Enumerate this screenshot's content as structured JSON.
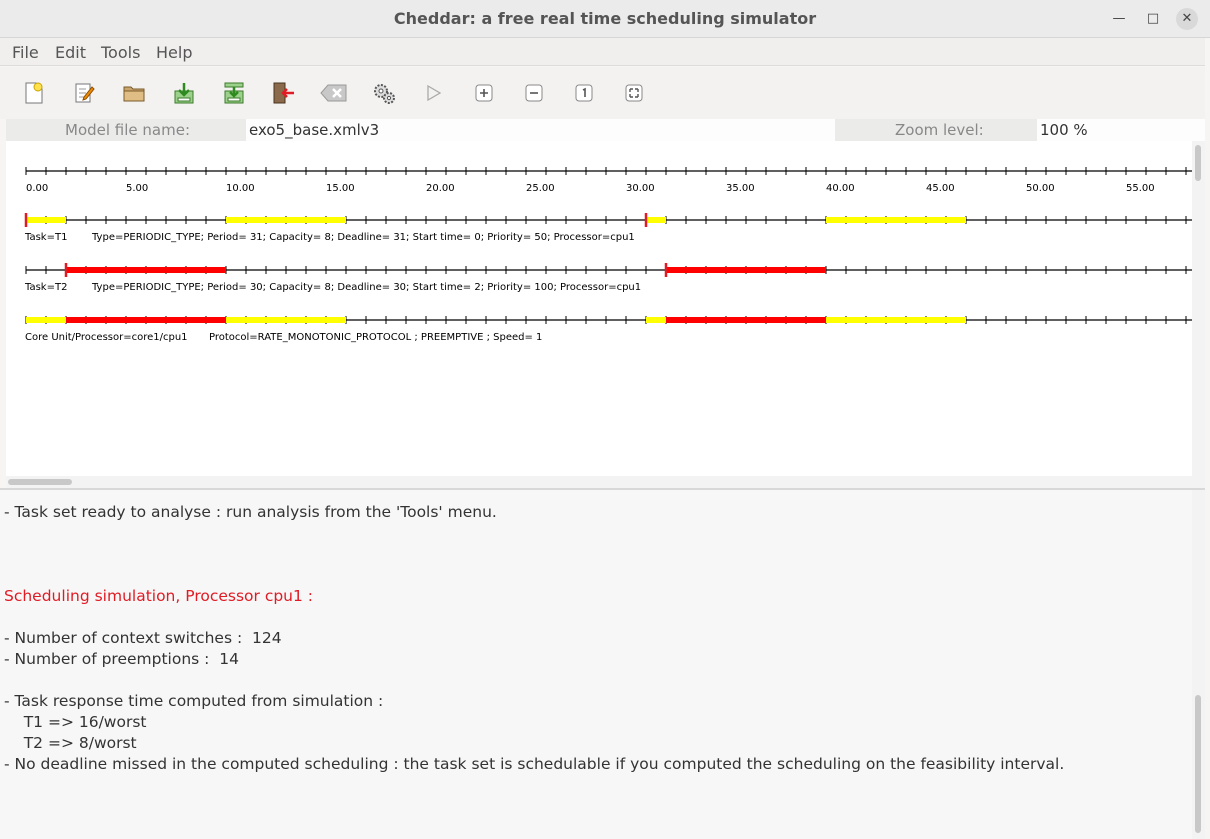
{
  "window": {
    "title": "Cheddar: a free real time scheduling simulator",
    "minimize_glyph": "—",
    "maximize_glyph": "□",
    "close_glyph": "✕"
  },
  "menu": [
    {
      "label": "File"
    },
    {
      "label": "Edit"
    },
    {
      "label": "Tools"
    },
    {
      "label": "Help"
    }
  ],
  "toolbar": {
    "icons": [
      "new-file-icon",
      "edit-icon",
      "open-folder-icon",
      "save-icon",
      "save-as-icon",
      "exit-icon",
      "clear-icon",
      "settings-gears-icon",
      "run-icon",
      "zoom-in-icon",
      "zoom-out-icon",
      "zoom-reset-icon",
      "zoom-fit-icon"
    ]
  },
  "model": {
    "file_label": "Model file name:",
    "file_value": "exo5_base.xmlv3",
    "zoom_label": "Zoom level:",
    "zoom_value": "100 %"
  },
  "timeline": {
    "tick_labels": [
      "0.00",
      "5.00",
      "10.00",
      "15.00",
      "20.00",
      "25.00",
      "30.00",
      "35.00",
      "40.00",
      "45.00",
      "50.00",
      "55.00"
    ],
    "range": [
      0,
      58
    ],
    "rows": [
      {
        "label": "Task=T1",
        "desc": "Type=PERIODIC_TYPE; Period= 31; Capacity= 8; Deadline= 31; Start time= 0; Priority= 50; Processor=cpu1",
        "segments": [
          {
            "start": 0,
            "end": 2,
            "color": "#ffff00"
          },
          {
            "start": 10,
            "end": 16,
            "color": "#ffff00"
          },
          {
            "start": 31,
            "end": 32,
            "color": "#ffff00"
          },
          {
            "start": 40,
            "end": 47,
            "color": "#ffff00"
          }
        ],
        "releases": [
          0,
          31
        ]
      },
      {
        "label": "Task=T2",
        "desc": "Type=PERIODIC_TYPE; Period= 30; Capacity= 8; Deadline= 30; Start time= 2; Priority= 100; Processor=cpu1",
        "segments": [
          {
            "start": 2,
            "end": 10,
            "color": "#ff0000"
          },
          {
            "start": 32,
            "end": 40,
            "color": "#ff0000"
          }
        ],
        "releases": [
          2,
          32
        ]
      },
      {
        "label": "Core Unit/Processor=core1/cpu1",
        "desc": "Protocol=RATE_MONOTONIC_PROTOCOL ; PREEMPTIVE ; Speed= 1",
        "segments": [
          {
            "start": 0,
            "end": 2,
            "color": "#ffff00"
          },
          {
            "start": 2,
            "end": 10,
            "color": "#ff0000"
          },
          {
            "start": 10,
            "end": 16,
            "color": "#ffff00"
          },
          {
            "start": 31,
            "end": 32,
            "color": "#ffff00"
          },
          {
            "start": 32,
            "end": 40,
            "color": "#ff0000"
          },
          {
            "start": 40,
            "end": 47,
            "color": "#ffff00"
          }
        ],
        "releases": []
      }
    ]
  },
  "log": {
    "lines": [
      {
        "text": "- Task set ready to analyse : run analysis from the 'Tools' menu.",
        "red": false
      },
      {
        "text": "Scheduling simulation, Processor cpu1 :",
        "red": true
      },
      {
        "text": "- Number of context switches :  124",
        "red": false
      },
      {
        "text": "- Number of preemptions :  14",
        "red": false
      },
      {
        "text": "- Task response time computed from simulation :",
        "red": false
      },
      {
        "text": "    T1 => 16/worst",
        "red": false
      },
      {
        "text": "    T2 => 8/worst",
        "red": false
      },
      {
        "text": "- No deadline missed in the computed scheduling : the task set is schedulable if you computed the scheduling on the feasibility interval.",
        "red": false
      }
    ]
  }
}
